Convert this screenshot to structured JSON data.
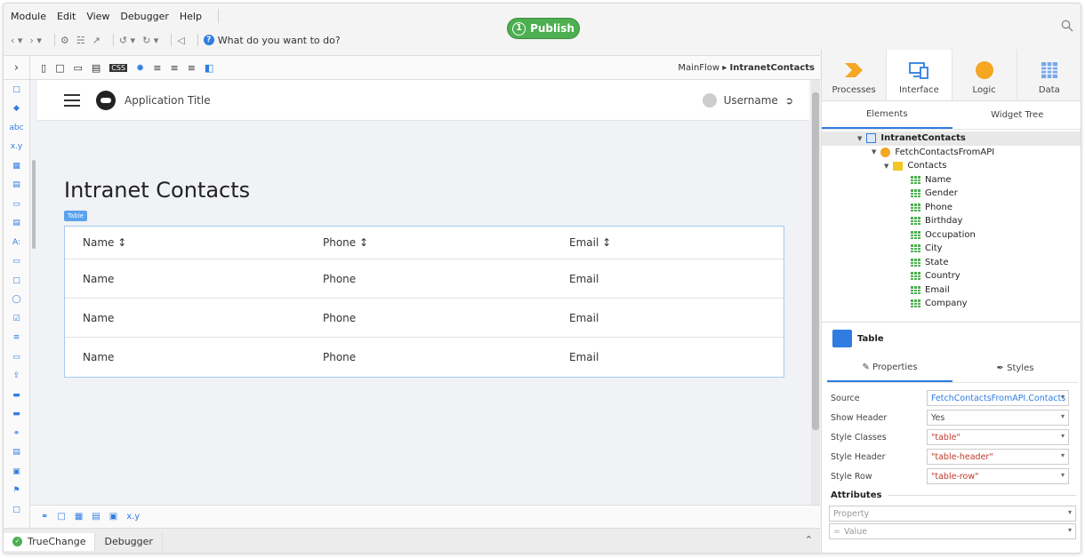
{
  "menu": [
    "Module",
    "Edit",
    "View",
    "Debugger",
    "Help"
  ],
  "toolbar": {
    "ask": "What do you want to do?"
  },
  "publish": {
    "step": "1",
    "label": "Publish"
  },
  "breadcrumb": {
    "flow": "MainFlow",
    "screen": "IntranetContacts"
  },
  "app": {
    "title": "Application Title",
    "user": "Username"
  },
  "page": {
    "title": "Intranet Contacts",
    "table_tag": "Table"
  },
  "table": {
    "headers": [
      "Name ↕",
      "Phone ↕",
      "Email ↕"
    ],
    "rows": [
      [
        "Name",
        "Phone",
        "Email"
      ],
      [
        "Name",
        "Phone",
        "Email"
      ],
      [
        "Name",
        "Phone",
        "Email"
      ]
    ]
  },
  "bottom": {
    "xy": "x.y"
  },
  "status": {
    "truechange": "TrueChange",
    "debugger": "Debugger"
  },
  "right": {
    "tabs": [
      "Processes",
      "Interface",
      "Logic",
      "Data"
    ],
    "subtabs": [
      "Elements",
      "Widget Tree"
    ],
    "tree": {
      "screen": "IntranetContacts",
      "aggregate": "FetchContactsFromAPI",
      "list": "Contacts",
      "attrs": [
        "Name",
        "Gender",
        "Phone",
        "Birthday",
        "Occupation",
        "City",
        "State",
        "Country",
        "Email",
        "Company"
      ]
    },
    "props": {
      "title": "Table",
      "tabs": [
        "Properties",
        "Styles"
      ],
      "rows": [
        {
          "label": "Source",
          "value": "FetchContactsFromAPI.Contacts"
        },
        {
          "label": "Show Header",
          "value": "Yes"
        },
        {
          "label": "Style Classes",
          "value": "\"table\""
        },
        {
          "label": "Style Header",
          "value": "\"table-header\""
        },
        {
          "label": "Style Row",
          "value": "\"table-row\""
        }
      ],
      "attributes_label": "Attributes",
      "property_placeholder": "Property",
      "value_placeholder": "Value"
    }
  }
}
